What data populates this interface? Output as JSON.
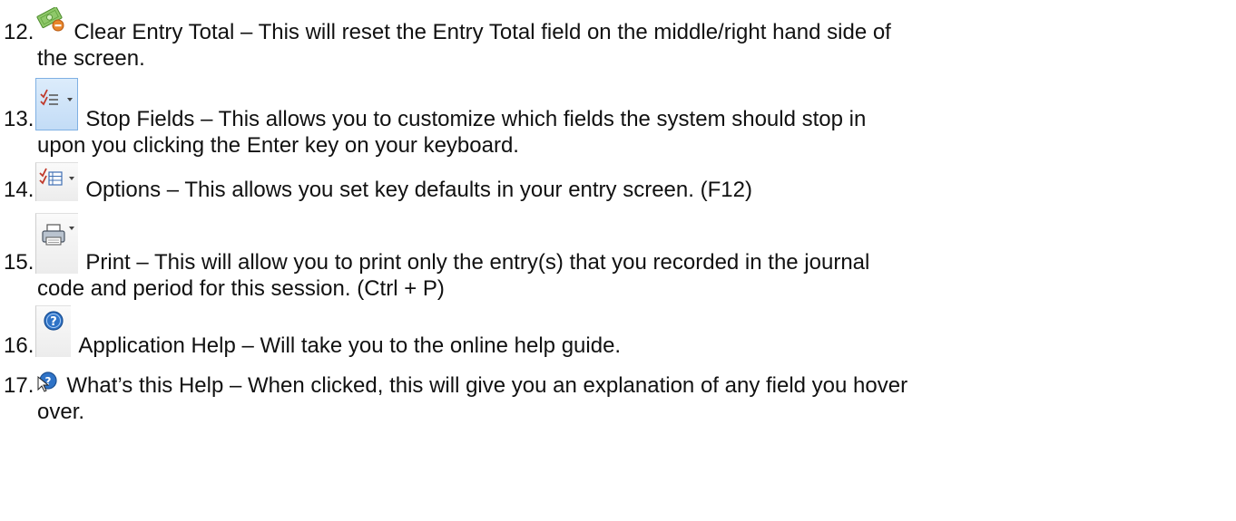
{
  "items": [
    {
      "number": "12.",
      "icon": "clear-total-money-icon",
      "line1": "Clear Entry Total – This will reset the Entry Total field on the middle/right hand side of",
      "line2": "the screen."
    },
    {
      "number": "13.",
      "icon": "stop-fields-icon",
      "line1": "Stop Fields – This allows you to customize which fields the system should stop in",
      "line2": "upon you clicking the Enter key on your keyboard."
    },
    {
      "number": "14.",
      "icon": "options-icon",
      "line1": "Options – This allows you set key defaults in your entry screen. (F12)"
    },
    {
      "number": "15.",
      "icon": "print-icon",
      "line1": "Print – This will allow you to print only the entry(s) that you recorded in the journal",
      "line2": "code and period for this session. (Ctrl + P)"
    },
    {
      "number": "16.",
      "icon": "help-icon",
      "line1": "Application Help – Will take you to the online help guide."
    },
    {
      "number": "17.",
      "icon": "whats-this-help-icon",
      "line1": "What’s this Help – When clicked, this will give you an explanation of any field you hover",
      "line2": "over."
    }
  ]
}
